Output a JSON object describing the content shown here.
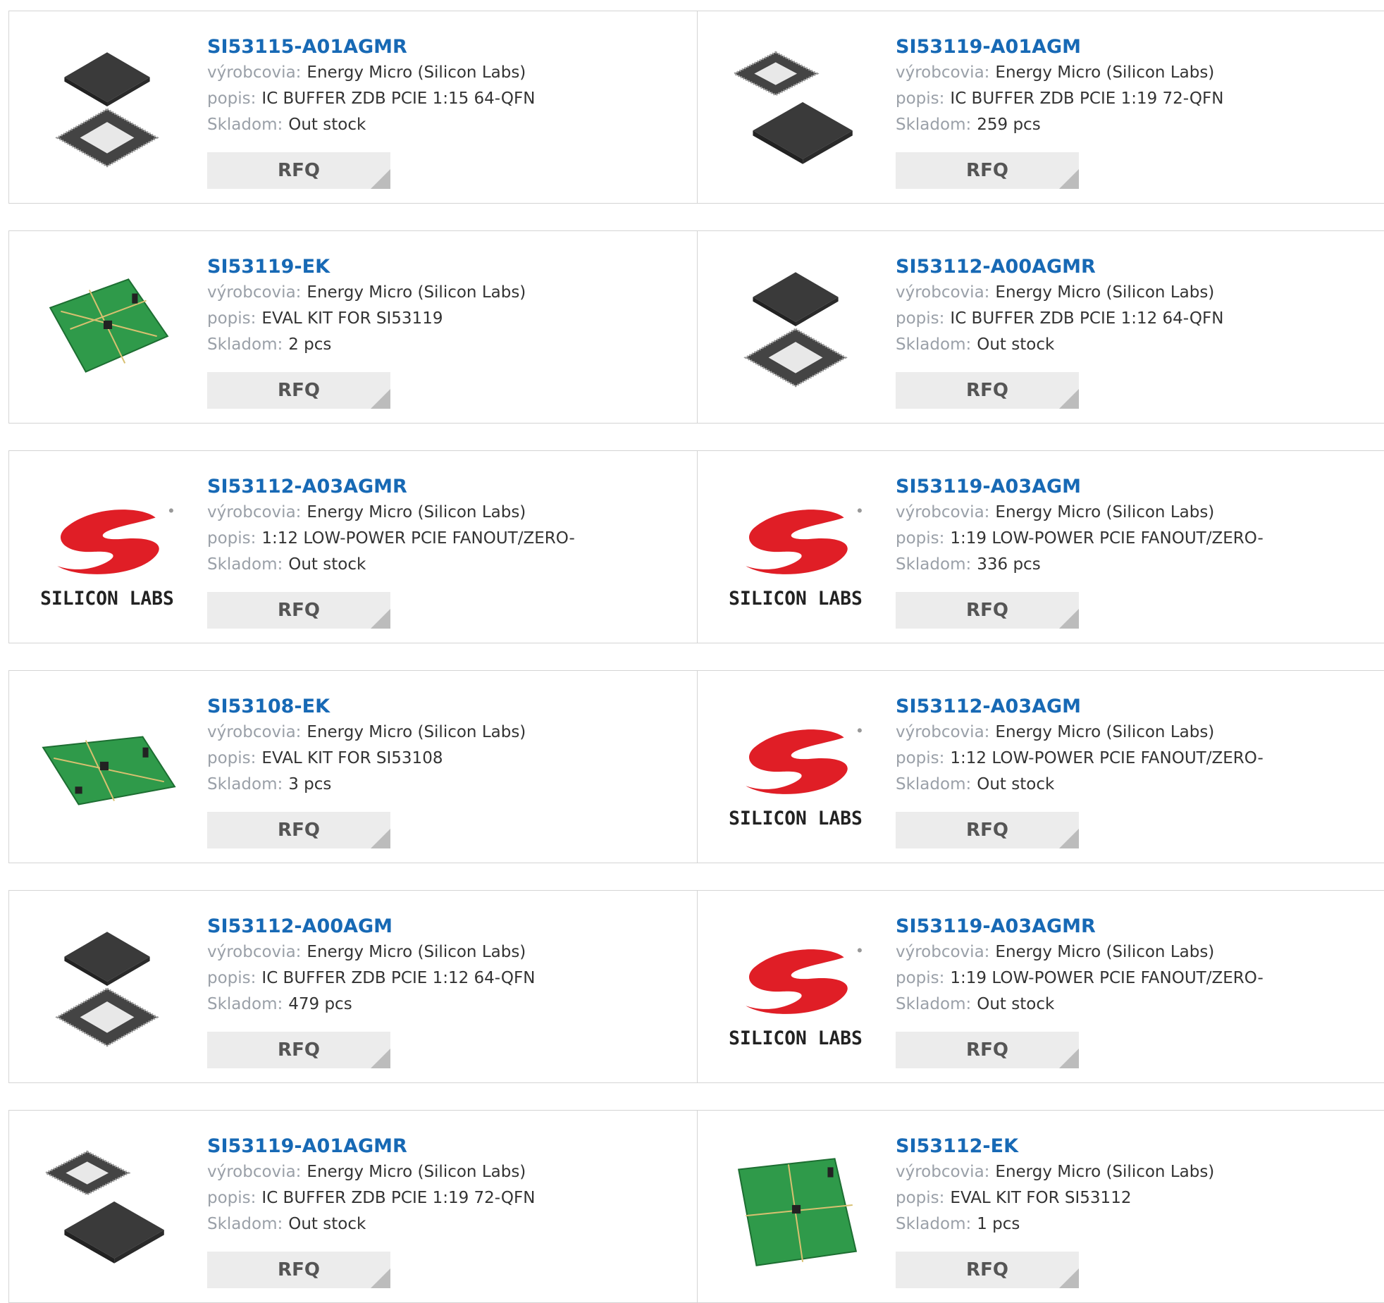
{
  "labels": {
    "manufacturer": "výrobcovia:",
    "description": "popis:",
    "stock": "Skladom:",
    "rfq": "RFQ"
  },
  "products": [
    {
      "part": "SI53115-A01AGMR",
      "manufacturer": "Energy Micro (Silicon Labs)",
      "description": "IC BUFFER ZDB PCIE 1:15 64-QFN",
      "stock": "Out stock",
      "image": "qfn-chip-image"
    },
    {
      "part": "SI53119-A01AGM",
      "manufacturer": "Energy Micro (Silicon Labs)",
      "description": "IC BUFFER ZDB PCIE 1:19 72-QFN",
      "stock": "259 pcs",
      "image": "qfn-chip-image-flipped"
    },
    {
      "part": "SI53119-EK",
      "manufacturer": "Energy Micro (Silicon Labs)",
      "description": "EVAL KIT FOR SI53119",
      "stock": "2 pcs",
      "image": "eval-board-image"
    },
    {
      "part": "SI53112-A00AGMR",
      "manufacturer": "Energy Micro (Silicon Labs)",
      "description": "IC BUFFER ZDB PCIE 1:12 64-QFN",
      "stock": "Out stock",
      "image": "qfn-chip-image"
    },
    {
      "part": "SI53112-A03AGMR",
      "manufacturer": "Energy Micro (Silicon Labs)",
      "description": "1:12 LOW-POWER PCIE FANOUT/ZERO-",
      "stock": "Out stock",
      "image": "silicon-labs-logo"
    },
    {
      "part": "SI53119-A03AGM",
      "manufacturer": "Energy Micro (Silicon Labs)",
      "description": "1:19 LOW-POWER PCIE FANOUT/ZERO-",
      "stock": "336 pcs",
      "image": "silicon-labs-logo"
    },
    {
      "part": "SI53108-EK",
      "manufacturer": "Energy Micro (Silicon Labs)",
      "description": "EVAL KIT FOR SI53108",
      "stock": "3 pcs",
      "image": "eval-board-image"
    },
    {
      "part": "SI53112-A03AGM",
      "manufacturer": "Energy Micro (Silicon Labs)",
      "description": "1:12 LOW-POWER PCIE FANOUT/ZERO-",
      "stock": "Out stock",
      "image": "silicon-labs-logo"
    },
    {
      "part": "SI53112-A00AGM",
      "manufacturer": "Energy Micro (Silicon Labs)",
      "description": "IC BUFFER ZDB PCIE 1:12 64-QFN",
      "stock": "479 pcs",
      "image": "qfn-chip-image"
    },
    {
      "part": "SI53119-A03AGMR",
      "manufacturer": "Energy Micro (Silicon Labs)",
      "description": "1:19 LOW-POWER PCIE FANOUT/ZERO-",
      "stock": "Out stock",
      "image": "silicon-labs-logo"
    },
    {
      "part": "SI53119-A01AGMR",
      "manufacturer": "Energy Micro (Silicon Labs)",
      "description": "IC BUFFER ZDB PCIE 1:19 72-QFN",
      "stock": "Out stock",
      "image": "qfn-chip-image-flipped"
    },
    {
      "part": "SI53112-EK",
      "manufacturer": "Energy Micro (Silicon Labs)",
      "description": "EVAL KIT FOR SI53112",
      "stock": "1 pcs",
      "image": "eval-board-image"
    }
  ],
  "logo_text": "SILICON LABS",
  "colors": {
    "part_link": "#1769b5",
    "label": "#9aa0a8",
    "value": "#333333",
    "rfq_bg": "#ececec",
    "logo_red": "#e01e26"
  }
}
